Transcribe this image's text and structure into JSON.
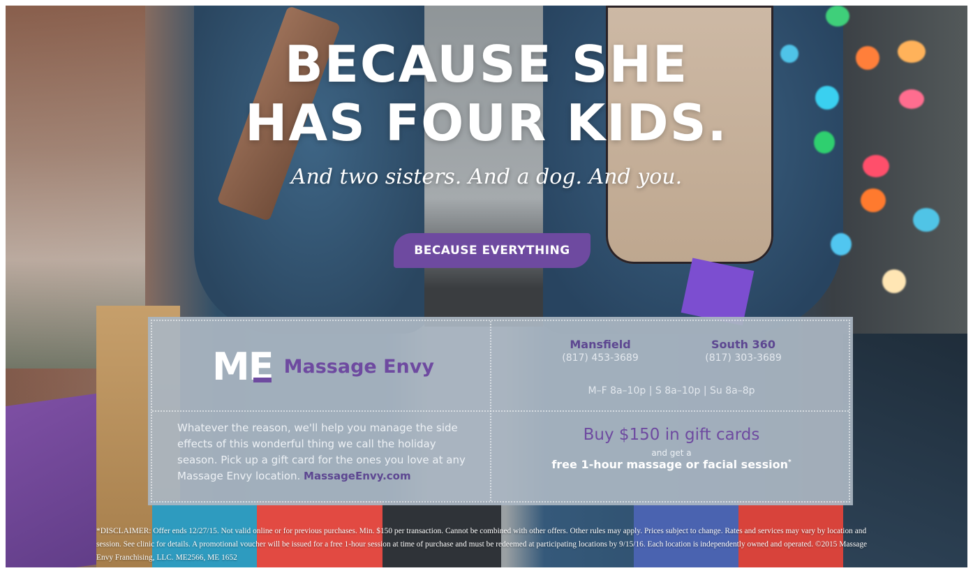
{
  "headline": {
    "line1": "BECAUSE SHE",
    "line2": "HAS FOUR KIDS.",
    "sub": "And two sisters. And a dog. And you."
  },
  "cta": {
    "label": "BECAUSE EVERYTHING"
  },
  "brand": {
    "logo_text": "ME",
    "name": "Massage Envy"
  },
  "locations": [
    {
      "name": "Mansfield",
      "phone": "(817) 453-3689"
    },
    {
      "name": "South 360",
      "phone": "(817) 303-3689"
    }
  ],
  "hours": "M–F 8a–10p | S 8a–10p | Su 8a–8p",
  "body": {
    "text": "Whatever the reason, we'll help you manage the side effects of this wonderful thing we call the holiday season. Pick up a gift card for the ones you love at any Massage Envy location.",
    "link": "MassageEnvy.com"
  },
  "offer": {
    "big": "Buy $150 in gift cards",
    "small": "and get a",
    "mid": "free 1-hour massage or facial session",
    "mark": "*"
  },
  "disclaimer": "*DISCLAIMER: Offer ends 12/27/15. Not valid online or for previous purchases. Min. $150 per transaction. Cannot be combined with other offers. Other rules may apply. Prices subject to change. Rates and services may vary by location and session. See clinic for details. A promotional voucher will be issued for a free 1-hour session at time of purchase and must be redeemed at participating locations by 9/15/16. Each location is independently owned and operated. ©2015 Massage Envy Franchising, LLC.   ME2566, ME 1652",
  "colors": {
    "purple": "#6e4aa0",
    "panel": "#aab6c2",
    "coat": "#35597a"
  }
}
